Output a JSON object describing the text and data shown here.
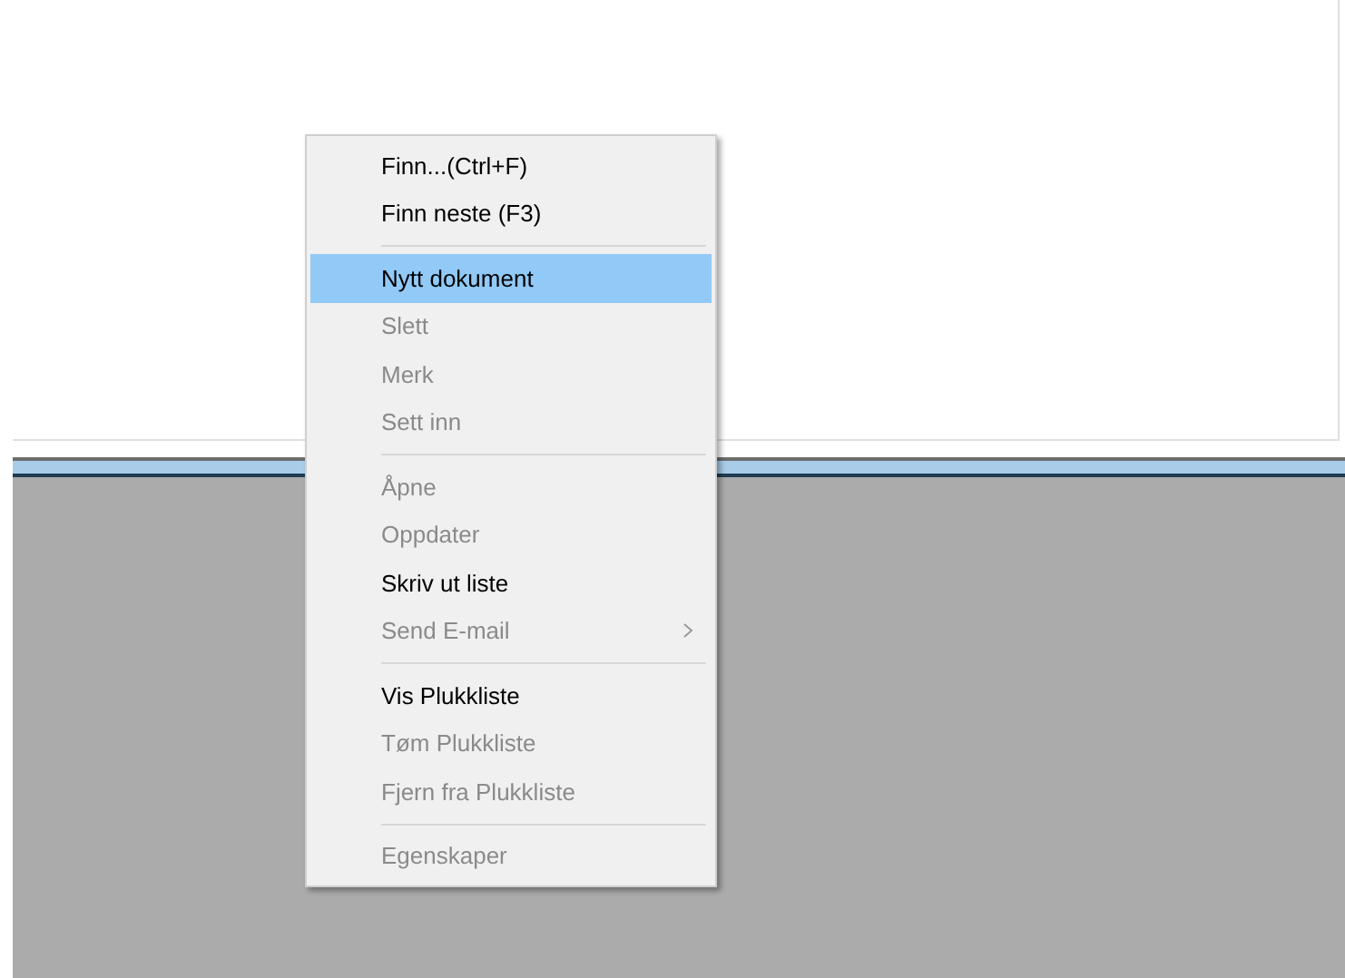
{
  "context_menu": {
    "entries": [
      {
        "kind": "item",
        "label": "Finn...(Ctrl+F)",
        "disabled": false,
        "selected": false,
        "submenu": false
      },
      {
        "kind": "item",
        "label": "Finn neste (F3)",
        "disabled": false,
        "selected": false,
        "submenu": false
      },
      {
        "kind": "separator"
      },
      {
        "kind": "item",
        "label": "Nytt dokument",
        "disabled": false,
        "selected": true,
        "submenu": false
      },
      {
        "kind": "item",
        "label": "Slett",
        "disabled": true,
        "selected": false,
        "submenu": false
      },
      {
        "kind": "item",
        "label": "Merk",
        "disabled": true,
        "selected": false,
        "submenu": false
      },
      {
        "kind": "item",
        "label": "Sett inn",
        "disabled": true,
        "selected": false,
        "submenu": false
      },
      {
        "kind": "separator"
      },
      {
        "kind": "item",
        "label": "Åpne",
        "disabled": true,
        "selected": false,
        "submenu": false
      },
      {
        "kind": "item",
        "label": "Oppdater",
        "disabled": true,
        "selected": false,
        "submenu": false
      },
      {
        "kind": "item",
        "label": "Skriv ut liste",
        "disabled": false,
        "selected": false,
        "submenu": false
      },
      {
        "kind": "item",
        "label": "Send E-mail",
        "disabled": true,
        "selected": false,
        "submenu": true
      },
      {
        "kind": "separator"
      },
      {
        "kind": "item",
        "label": "Vis Plukkliste",
        "disabled": false,
        "selected": false,
        "submenu": false
      },
      {
        "kind": "item",
        "label": "Tøm Plukkliste",
        "disabled": true,
        "selected": false,
        "submenu": false
      },
      {
        "kind": "item",
        "label": "Fjern fra Plukkliste",
        "disabled": true,
        "selected": false,
        "submenu": false
      },
      {
        "kind": "separator"
      },
      {
        "kind": "item",
        "label": "Egenskaper",
        "disabled": true,
        "selected": false,
        "submenu": false
      }
    ]
  }
}
